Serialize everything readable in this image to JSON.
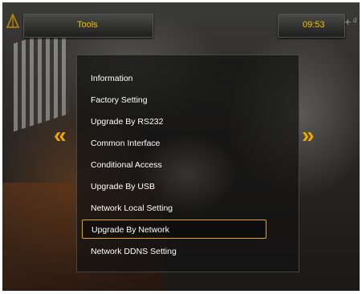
{
  "header": {
    "title": "Tools",
    "time": "09:53"
  },
  "icons": {
    "logo": "antenna-logo-icon",
    "plus": "+",
    "signal": "d"
  },
  "nav": {
    "left_arrow": "«",
    "right_arrow": "»"
  },
  "menu": {
    "selected_index": 7,
    "items": [
      {
        "label": "Information"
      },
      {
        "label": "Factory Setting"
      },
      {
        "label": "Upgrade By RS232"
      },
      {
        "label": "Common Interface"
      },
      {
        "label": "Conditional Access"
      },
      {
        "label": "Upgrade By USB"
      },
      {
        "label": "Network Local Setting"
      },
      {
        "label": "Upgrade By Network"
      },
      {
        "label": "Network DDNS Setting"
      }
    ]
  },
  "colors": {
    "accent": "#f0c300",
    "arrow": "#f0a800",
    "selection_border": "#e0a800"
  }
}
